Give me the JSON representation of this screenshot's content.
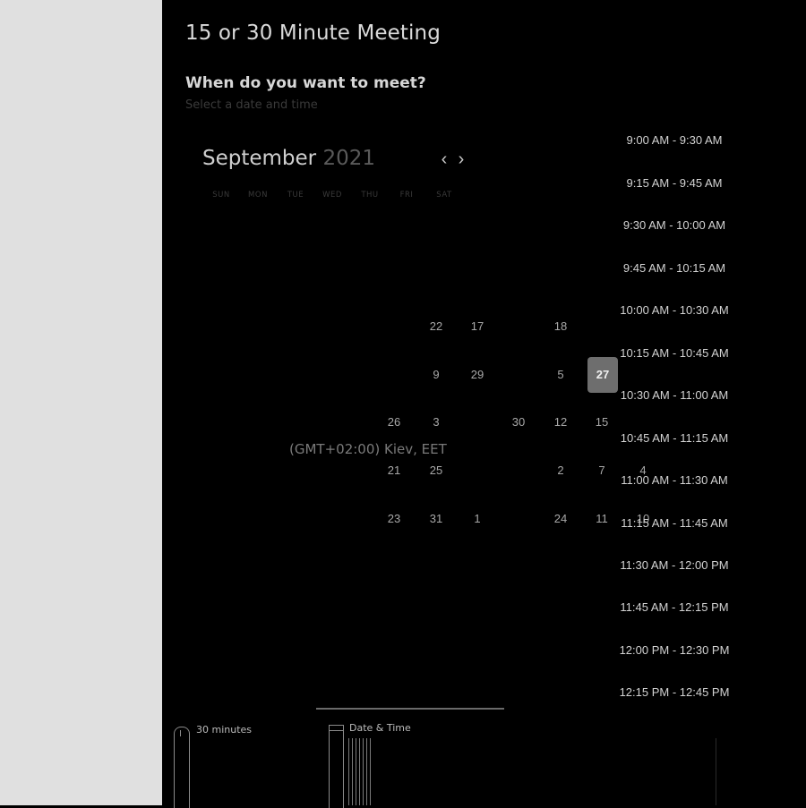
{
  "meeting": {
    "title": "15 or 30 Minute Meeting",
    "question": "When do you want to meet?",
    "subtitle": "Select a date and time"
  },
  "calendar": {
    "month": "September",
    "year": "2021",
    "prev_icon": "chevron-left-icon",
    "next_icon": "chevron-right-icon",
    "weekdays": [
      "SUN",
      "MON",
      "TUE",
      "WED",
      "THU",
      "FRI",
      "SAT"
    ],
    "selected_day": "27",
    "days": [
      [
        "22",
        "17",
        "18"
      ],
      [
        "9",
        "29",
        "5",
        "27"
      ],
      [
        "26",
        "3",
        "30",
        "12",
        "15"
      ],
      [
        "21",
        "25",
        "2",
        "7",
        "4"
      ],
      [
        "23",
        "31",
        "1",
        "24",
        "11",
        "10"
      ]
    ]
  },
  "timezone": "(GMT+02:00) Kiev, EET",
  "time_slots": [
    "9:00 AM - 9:30 AM",
    "9:15 AM - 9:45 AM",
    "9:30 AM - 10:00 AM",
    "9:45 AM - 10:15 AM",
    "10:00 AM - 10:30 AM",
    "10:15 AM - 10:45 AM",
    "10:30 AM - 11:00 AM",
    "10:45 AM - 11:15 AM",
    "11:00 AM - 11:30 AM",
    "11:15 AM - 11:45 AM",
    "11:30 AM - 12:00 PM",
    "11:45 AM - 12:15 PM",
    "12:00 PM - 12:30 PM",
    "12:15 PM - 12:45 PM"
  ],
  "footer": {
    "duration_label": "30 minutes",
    "duration_icon": "clock-icon",
    "datetime_label": "Date & Time",
    "datetime_icon": "calendar-icon"
  },
  "colors": {
    "background": "#000000",
    "sidebar": "#e0e0e0",
    "selected_day": "#6e6e6e"
  }
}
